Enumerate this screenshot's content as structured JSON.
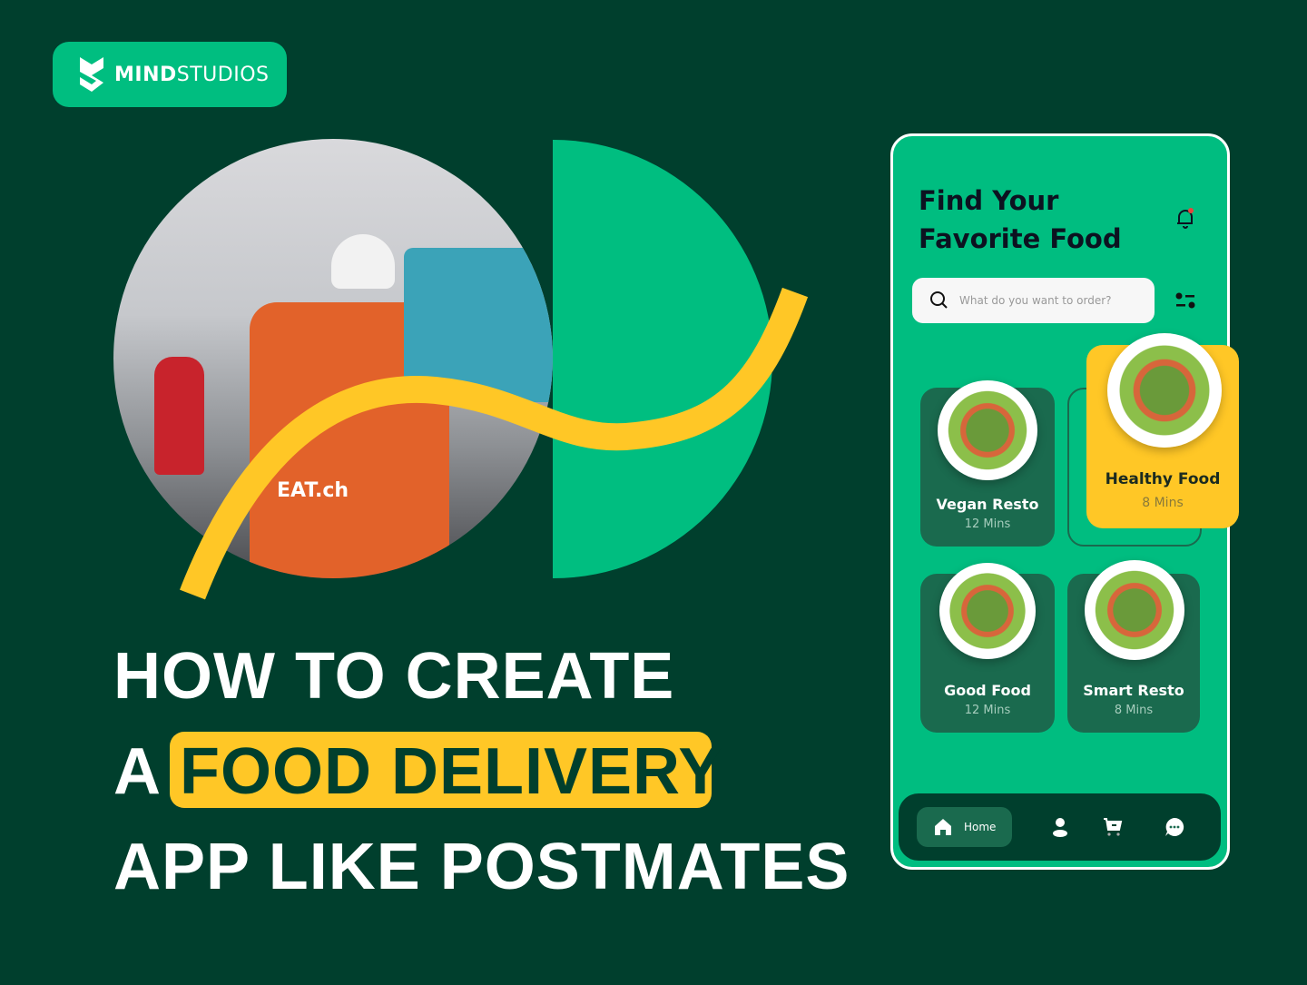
{
  "brand": {
    "name_bold": "MIND",
    "name_light": "STUDIOS"
  },
  "headline": {
    "line1": "HOW TO CREATE",
    "line2_prefix": "A",
    "line2_highlight": "FOOD DELIVERY",
    "line3": "APP LIKE POSTMATES"
  },
  "photo": {
    "bag_text": "EAT.ch"
  },
  "app": {
    "title_line1": "Find Your",
    "title_line2": "Favorite Food",
    "search": {
      "placeholder": "What do you want to order?"
    },
    "cards": [
      {
        "name": "Vegan Resto",
        "time": "12 Mins"
      },
      {
        "name": "Healthy Food",
        "time": "8 Mins"
      },
      {
        "name": "Good Food",
        "time": "12 Mins"
      },
      {
        "name": "Smart Resto",
        "time": "8 Mins"
      }
    ],
    "nav": {
      "home": "Home"
    }
  },
  "colors": {
    "background": "#003f2d",
    "brand_green": "#00be80",
    "accent_yellow": "#ffc726"
  }
}
